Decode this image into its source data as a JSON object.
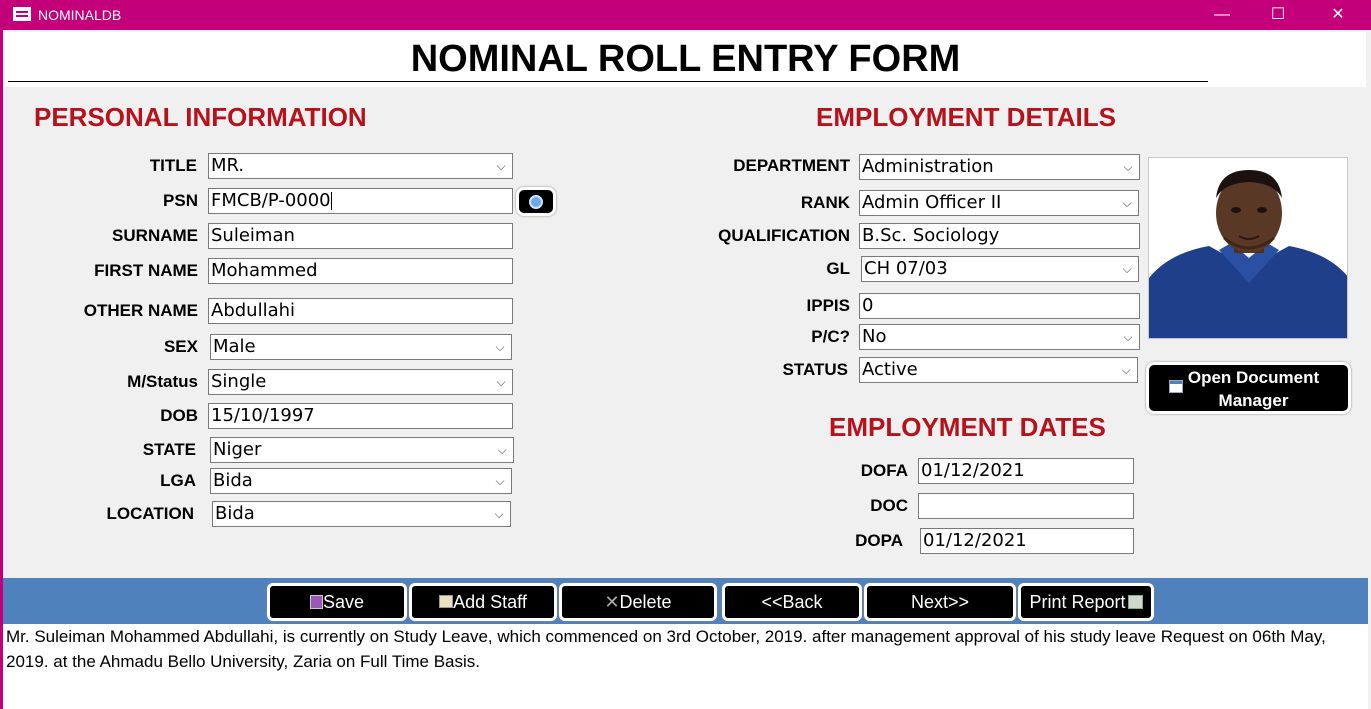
{
  "window": {
    "app_name": "NOMINALDB",
    "minimize": "—",
    "maximize": "☐",
    "close": "✕"
  },
  "form_title": "NOMINAL ROLL ENTRY FORM",
  "personal": {
    "heading": "PERSONAL INFORMATION",
    "title": {
      "label": "TITLE",
      "value": "MR."
    },
    "psn": {
      "label": "PSN",
      "value": "FMCB/P-0000"
    },
    "surname": {
      "label": "SURNAME",
      "value": "Suleiman"
    },
    "first_name": {
      "label": "FIRST NAME",
      "value": "Mohammed"
    },
    "other_name": {
      "label": "OTHER NAME",
      "value": "Abdullahi"
    },
    "sex": {
      "label": "SEX",
      "value": "Male"
    },
    "marital_status": {
      "label": "M/Status",
      "value": "Single"
    },
    "dob": {
      "label": "DOB",
      "value": "15/10/1997"
    },
    "state": {
      "label": "STATE",
      "value": "Niger"
    },
    "lga": {
      "label": "LGA",
      "value": "Bida"
    },
    "location": {
      "label": "LOCATION",
      "value": "Bida"
    }
  },
  "employment": {
    "heading": "EMPLOYMENT DETAILS",
    "department": {
      "label": "DEPARTMENT",
      "value": "Administration"
    },
    "rank": {
      "label": "RANK",
      "value": "Admin Officer II"
    },
    "qualification": {
      "label": "QUALIFICATION",
      "value": "B.Sc. Sociology"
    },
    "gl": {
      "label": "GL",
      "value": "CH 07/03"
    },
    "ippis": {
      "label": "IPPIS",
      "value": "0"
    },
    "pc": {
      "label": "P/C?",
      "value": "No"
    },
    "status": {
      "label": "STATUS",
      "value": "Active"
    }
  },
  "dates": {
    "heading": "EMPLOYMENT DATES",
    "dofa": {
      "label": "DOFA",
      "value": "01/12/2021"
    },
    "doc": {
      "label": "DOC",
      "value": ""
    },
    "dopa": {
      "label": "DOPA",
      "value": "01/12/2021"
    }
  },
  "document_manager": {
    "line1": "Open Document",
    "line2": "Manager"
  },
  "toolbar": {
    "save": "Save",
    "add_staff": "Add Staff",
    "delete": "Delete",
    "back": "<<Back",
    "next": "Next>>",
    "print": "Print Report"
  },
  "remark": "Mr. Suleiman Mohammed Abdullahi, is currently on Study Leave, which commenced on 3rd October, 2019. after management approval of his study leave Request on 06th May, 2019. at the Ahmadu Bello University, Zaria on Full Time Basis.",
  "icons": {
    "app": "form-icon",
    "search": "magnifier-icon",
    "document": "document-icon",
    "save": "save-icon",
    "add": "add-staff-icon",
    "delete": "delete-icon",
    "print": "print-icon"
  },
  "colors": {
    "titlebar": "#c3007a",
    "section_heading": "#b5121b",
    "toolbar_band": "#4f81bd"
  }
}
